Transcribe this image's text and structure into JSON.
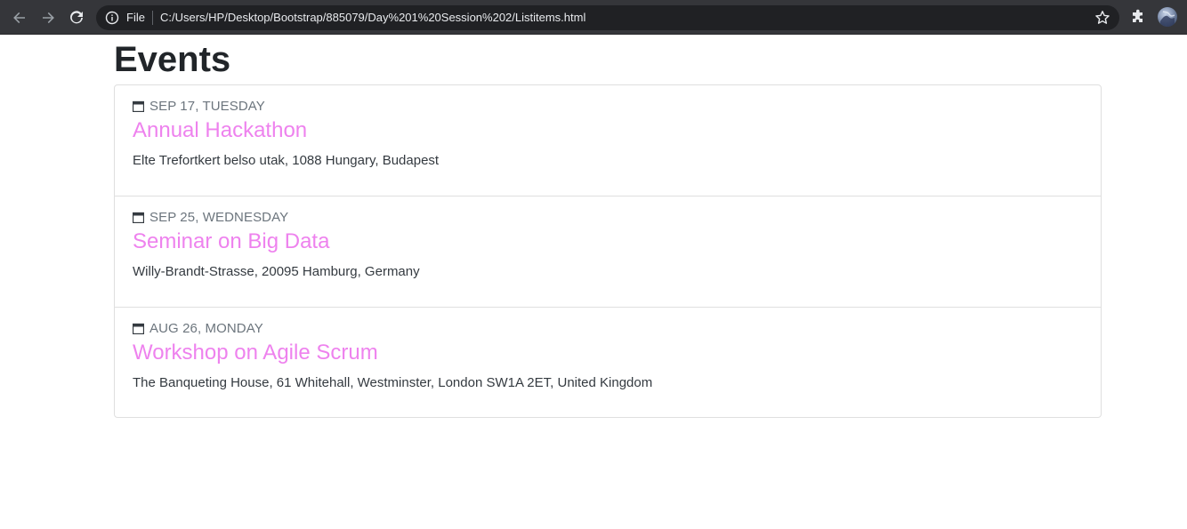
{
  "browser": {
    "scheme_label": "File",
    "url": "C:/Users/HP/Desktop/Bootstrap/885079/Day%201%20Session%202/Listitems.html",
    "icons": {
      "back": "arrow-left-icon",
      "forward": "arrow-right-icon",
      "reload": "reload-icon",
      "info": "info-icon",
      "bookmark": "star-icon",
      "extensions": "puzzle-icon",
      "profile": "avatar"
    }
  },
  "page": {
    "title": "Events",
    "accent_color": "#ee82ee",
    "events": [
      {
        "date": "SEP 17, TUESDAY",
        "title": "Annual Hackathon",
        "address": "Elte Trefortkert belso utak, 1088 Hungary, Budapest"
      },
      {
        "date": "SEP 25, WEDNESDAY",
        "title": "Seminar on Big Data",
        "address": "Willy-Brandt-Strasse, 20095 Hamburg, Germany"
      },
      {
        "date": "AUG 26, MONDAY",
        "title": "Workshop on Agile Scrum",
        "address": "The Banqueting House, 61 Whitehall, Westminster, London SW1A 2ET, United Kingdom"
      }
    ]
  }
}
